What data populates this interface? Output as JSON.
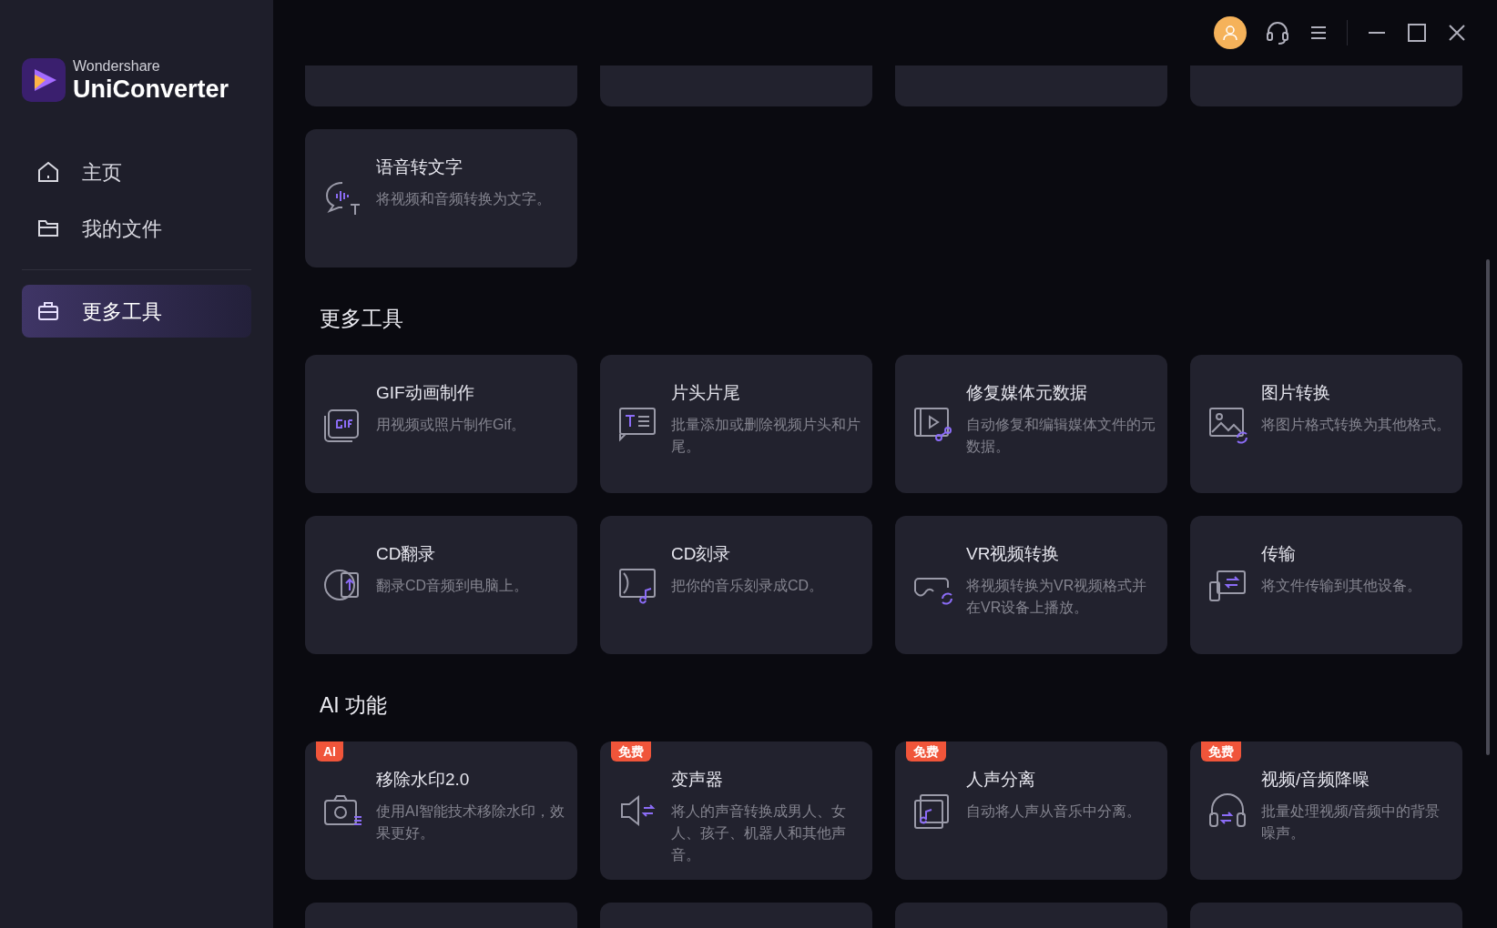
{
  "app": {
    "brand_small": "Wondershare",
    "brand_name": "UniConverter"
  },
  "sidebar": {
    "items": [
      {
        "label": "主页",
        "selected": false
      },
      {
        "label": "我的文件",
        "selected": false
      }
    ],
    "tools_items": [
      {
        "label": "更多工具",
        "selected": true
      }
    ]
  },
  "top_cards": [
    {
      "title": "语音转文字",
      "description": "将视频和音频转换为文字。"
    }
  ],
  "sections": [
    {
      "title": "更多工具",
      "cards": [
        {
          "title": "GIF动画制作",
          "description": "用视频或照片制作Gif。"
        },
        {
          "title": "片头片尾",
          "description": "批量添加或删除视频片头和片尾。"
        },
        {
          "title": "修复媒体元数据",
          "description": "自动修复和编辑媒体文件的元数据。"
        },
        {
          "title": "图片转换",
          "description": "将图片格式转换为其他格式。"
        },
        {
          "title": "CD翻录",
          "description": "翻录CD音频到电脑上。"
        },
        {
          "title": "CD刻录",
          "description": "把你的音乐刻录成CD。"
        },
        {
          "title": "VR视频转换",
          "description": "将视频转换为VR视频格式并在VR设备上播放。"
        },
        {
          "title": "传输",
          "description": "将文件传输到其他设备。"
        }
      ]
    },
    {
      "title": "AI 功能",
      "cards": [
        {
          "title": "移除水印2.0",
          "description": "使用AI智能技术移除水印，效果更好。",
          "badge": "AI"
        },
        {
          "title": "变声器",
          "description": "将人的声音转换成男人、女人、孩子、机器人和其他声音。",
          "badge": "免费"
        },
        {
          "title": "人声分离",
          "description": "自动将人声从音乐中分离。",
          "badge": "免费"
        },
        {
          "title": "视频/音频降噪",
          "description": "批量处理视频/音频中的背景噪声。",
          "badge": "免费"
        }
      ]
    }
  ]
}
